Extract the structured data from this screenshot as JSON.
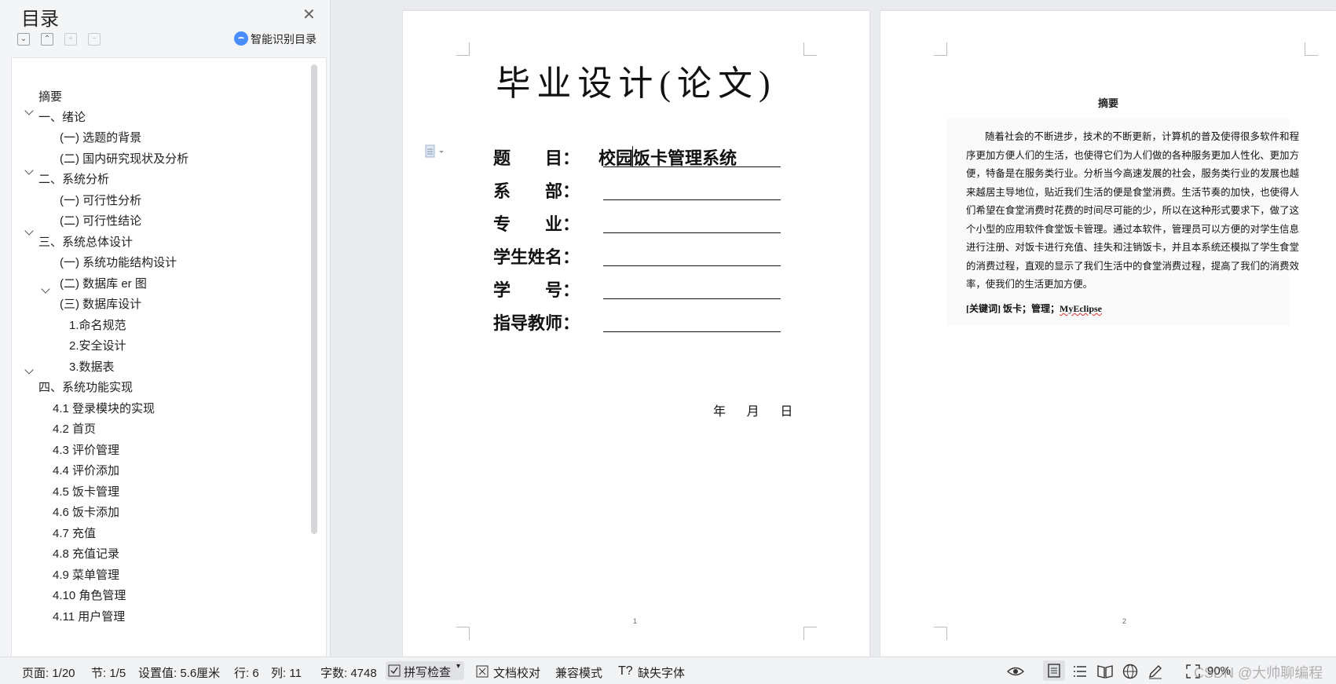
{
  "toc": {
    "title": "目录",
    "smart_label": "智能识别目录",
    "items": [
      {
        "label": "摘要"
      },
      {
        "label": "一、绪论"
      },
      {
        "label": "(一) 选题的背景"
      },
      {
        "label": "(二) 国内研究现状及分析"
      },
      {
        "label": "二、系统分析"
      },
      {
        "label": "(一) 可行性分析"
      },
      {
        "label": "(二) 可行性结论"
      },
      {
        "label": "三、系统总体设计"
      },
      {
        "label": "(一) 系统功能结构设计"
      },
      {
        "label": "(二) 数据库 er 图"
      },
      {
        "label": "(三) 数据库设计"
      },
      {
        "label": "1.命名规范"
      },
      {
        "label": "2.安全设计"
      },
      {
        "label": "3.数据表"
      },
      {
        "label": "四、系统功能实现"
      },
      {
        "label": "4.1 登录模块的实现"
      },
      {
        "label": "4.2 首页"
      },
      {
        "label": "4.3 评价管理"
      },
      {
        "label": "4.4 评价添加"
      },
      {
        "label": "4.5 饭卡管理"
      },
      {
        "label": "4.6 饭卡添加"
      },
      {
        "label": "4.7 充值"
      },
      {
        "label": "4.8 充值记录"
      },
      {
        "label": "4.9 菜单管理"
      },
      {
        "label": "4.10 角色管理"
      },
      {
        "label": "4.11 用户管理"
      }
    ]
  },
  "page1": {
    "title": "毕业设计(论文)",
    "fields": [
      {
        "label": "题　　目：",
        "value": "校园饭卡管理系统"
      },
      {
        "label": "系　　部："
      },
      {
        "label": "专　　业："
      },
      {
        "label": "学生姓名："
      },
      {
        "label": "学　　号："
      },
      {
        "label": "指导教师："
      }
    ],
    "date_text": "年      月      日",
    "page_number": "1"
  },
  "page2": {
    "abstract_title": "摘要",
    "abstract_text": "随着社会的不断进步，技术的不断更新，计算机的普及使得很多软件和程序更加方便人们的生活，也使得它们为人们做的各种服务更加人性化、更加方便，特备是在服务类行业。分析当今高速发展的社会，服务类行业的发展也越来越居主导地位，贴近我们生活的便是食堂消费。生活节奏的加快，也使得人们希望在食堂消费时花费的时间尽可能的少，所以在这种形式要求下，做了这个小型的应用软件食堂饭卡管理。通过本软件，管理员可以方便的对学生信息进行注册、对饭卡进行充值、挂失和注销饭卡，并且本系统还模拟了学生食堂的消费过程，直观的显示了我们生活中的食堂消费过程，提高了我们的消费效率，使我们的生活更加方便。",
    "keywords_label": "[关键词]",
    "keywords": "饭卡；管理；",
    "keyword_last": "MyEclipse",
    "page_number": "2"
  },
  "status": {
    "page": "页面: 1/20",
    "section": "节: 1/5",
    "setting": "设置值: 5.6厘米",
    "row": "行: 6",
    "col": "列: 11",
    "word_count": "字数: 4748",
    "spell_check": "拼写检查",
    "doc_proof": "文档校对",
    "compat_mode": "兼容模式",
    "missing_font": "缺失字体",
    "zoom": "90%",
    "watermark": "CSDN @大帅聊编程"
  }
}
